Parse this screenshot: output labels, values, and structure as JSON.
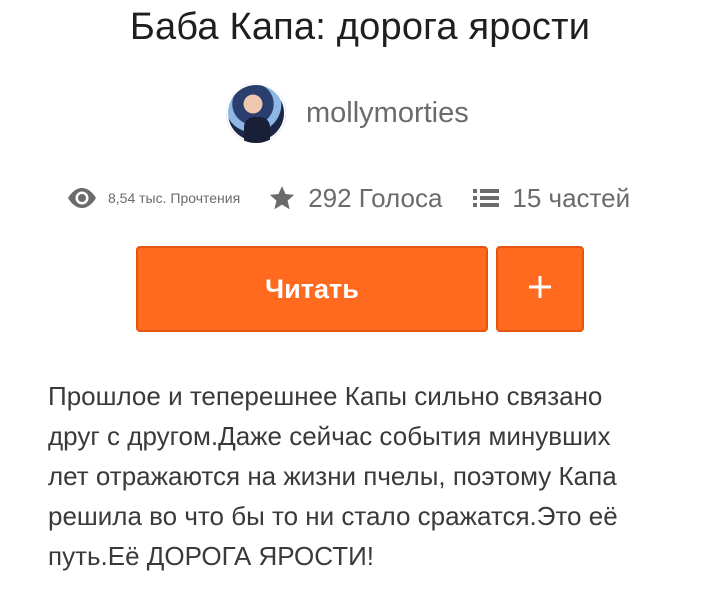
{
  "story": {
    "title": "Баба Капа: дорога ярости",
    "author": "mollymorties",
    "stats": {
      "reads": "8,54 тыс. Прочтения",
      "votes": "292 Голоса",
      "parts": "15 частей"
    },
    "actions": {
      "read_label": "Читать",
      "add_label": "+"
    },
    "description_lines": [
      "Прошлое и теперешнее Капы сильно связано",
      "друг с другом.Даже сейчас события минувших",
      "лет отражаются на жизни пчелы, поэтому Капа",
      "решила во что бы то ни стало сражатся.Это её",
      "путь.Её ДОРОГА ЯРОСТИ!"
    ]
  },
  "icons": {
    "reads": "eye-icon",
    "votes": "star-icon",
    "parts": "list-icon",
    "add": "plus-icon"
  },
  "colors": {
    "accent": "#ff6a1f",
    "muted_text": "#6b6b6b",
    "title_text": "#1f1f1f"
  }
}
